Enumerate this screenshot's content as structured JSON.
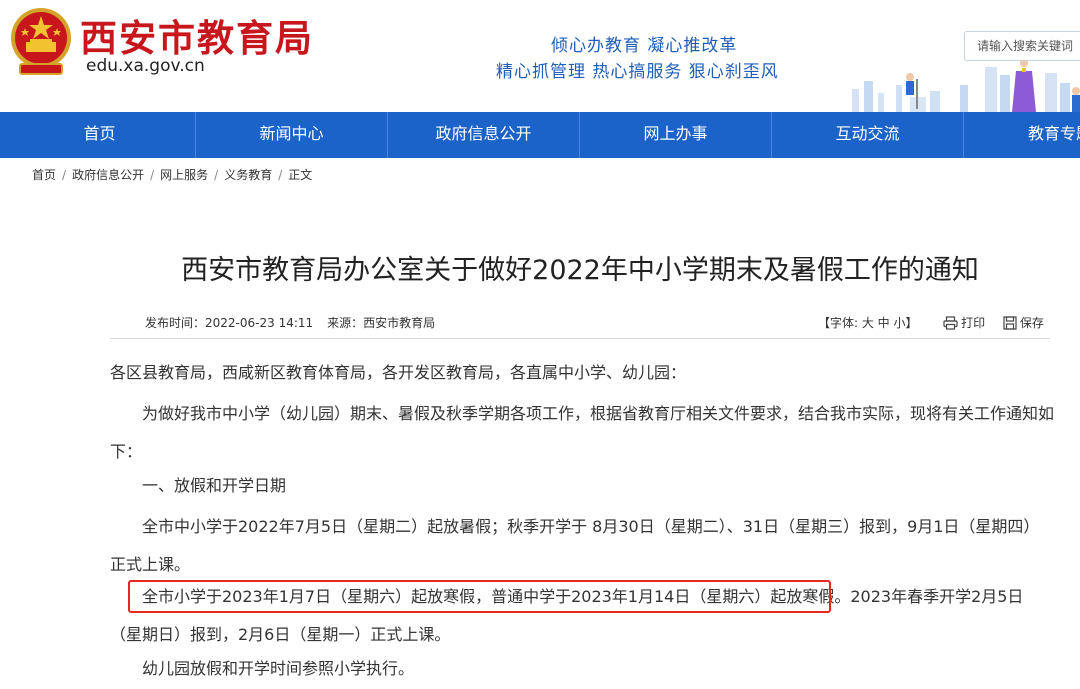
{
  "header": {
    "site_name": "西安市教育局",
    "domain": "edu.xa.gov.cn",
    "slogan_line1": "倾心办教育  凝心推改革",
    "slogan_line2": "精心抓管理  热心搞服务  狠心刹歪风",
    "search_placeholder": "请输入搜索关键词"
  },
  "nav": {
    "items": [
      "首页",
      "新闻中心",
      "政府信息公开",
      "网上办事",
      "互动交流",
      "教育专题"
    ]
  },
  "breadcrumb": [
    "首页",
    "政府信息公开",
    "网上服务",
    "义务教育",
    "正文"
  ],
  "article": {
    "title": "西安市教育局办公室关于做好2022年中小学期末及暑假工作的通知",
    "publish_label": "发布时间：",
    "publish_time": "2022-06-23 14:11",
    "source_label": "来源：",
    "source": "西安市教育局",
    "font_size_label": "【字体: 大 中 小】",
    "print_label": "打印",
    "save_label": "保存",
    "salutation": "各区县教育局，西咸新区教育体育局，各开发区教育局，各直属中小学、幼儿园：",
    "intro": "为做好我市中小学（幼儿园）期末、暑假及秋季学期各项工作，根据省教育厅相关文件要求，结合我市实际，现将有关工作通知如下：",
    "section1": "一、放假和开学日期",
    "summer": "全市中小学于2022年7月5日（星期二）起放暑假；秋季开学于 8月30日（星期二）、31日（星期三）报到，9月1日（星期四）正式上课。",
    "winter_highlight": "全市小学于2023年1月7日（星期六）起放寒假，普通中学于2023年1月14日（星期六）起放寒假。",
    "winter_rest": "2023年春季开学2月5日（星期日）报到，2月6日（星期一）正式上课。",
    "kindergarten": "幼儿园放假和开学时间参照小学执行。"
  },
  "colors": {
    "brand_red": "#c8161d",
    "nav_blue": "#1b62c9",
    "slogan_blue": "#1f5fb8",
    "highlight_red": "#e52820"
  },
  "icons": {
    "emblem": "national-emblem-icon",
    "print": "printer-icon",
    "save": "save-disk-icon"
  }
}
